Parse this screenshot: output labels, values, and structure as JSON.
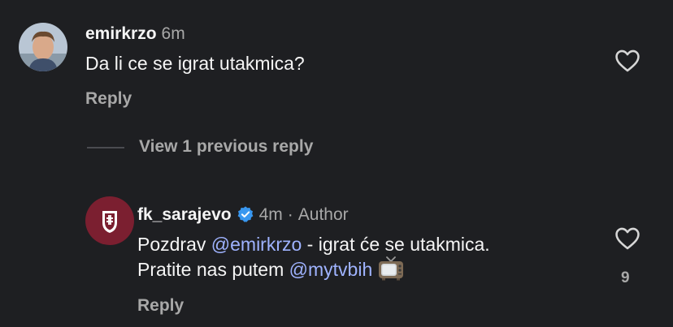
{
  "comment1": {
    "username": "emirkrzo",
    "time": "6m",
    "text": "Da li ce se igrat utakmica?",
    "reply_label": "Reply",
    "like_icon": "heart-outline-icon"
  },
  "view_replies": {
    "label": "View 1 previous reply"
  },
  "comment2": {
    "username": "fk_sarajevo",
    "verified_icon": "verified-badge-icon",
    "time": "4m",
    "separator": "·",
    "author_tag": "Author",
    "line1_prefix": "Pozdrav ",
    "mention1": "@emirkrzo",
    "line1_suffix": " - igrat će se utakmica.",
    "line2_prefix": "Pratite nas putem ",
    "mention2": "@mytvbih",
    "emoji": "television-emoji",
    "reply_label": "Reply",
    "like_icon": "heart-outline-icon",
    "like_count": "9"
  },
  "colors": {
    "background": "#1e1f22",
    "text": "#f5f5f5",
    "secondary": "#a8a8a8",
    "mention": "#9fb3ff",
    "verified": "#3897f0",
    "club_avatar": "#7b1f30"
  }
}
